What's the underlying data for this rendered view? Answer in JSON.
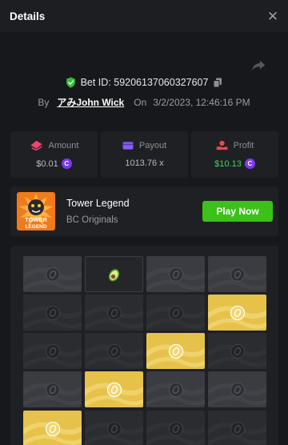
{
  "header": {
    "title": "Details",
    "close": "✕"
  },
  "bet": {
    "id_label": "Bet ID: 59206137060327607",
    "by_label": "By",
    "user": "アみJohn Wick",
    "on_label": "On",
    "timestamp": "3/2/2023, 12:46:16 PM"
  },
  "stats": {
    "amount": {
      "label": "Amount",
      "value": "$0.01"
    },
    "payout": {
      "label": "Payout",
      "value": "1013.76 x"
    },
    "profit": {
      "label": "Profit",
      "value": "$10.13"
    }
  },
  "game": {
    "name": "Tower Legend",
    "provider": "BC Originals",
    "play_label": "Play Now",
    "thumb_text_1": "TOWER",
    "thumb_text_2": "LEGEND"
  },
  "board": {
    "rows": [
      [
        "light",
        "revealed-avocado",
        "light",
        "light"
      ],
      [
        "dark",
        "dark",
        "dark",
        "gold"
      ],
      [
        "dark",
        "dark",
        "gold",
        "dark"
      ],
      [
        "light",
        "gold",
        "light",
        "light"
      ],
      [
        "gold",
        "dark",
        "dark",
        "dark"
      ]
    ]
  },
  "colors": {
    "background": "#17181b",
    "card": "#1f2024",
    "accent_green": "#3bc117",
    "profit_green": "#3fd45a",
    "coin_purple": "#7c3aed",
    "tile_gold": "#e6c24a"
  },
  "icons": {
    "close": "close-icon",
    "share": "share-icon",
    "shield": "shield-check-icon",
    "copy": "copy-icon",
    "amount": "money-icon",
    "payout": "wallet-icon",
    "profit": "profit-icon",
    "coin": "bcd-coin-icon",
    "tile": "coin-icon",
    "avocado": "avocado-icon"
  }
}
